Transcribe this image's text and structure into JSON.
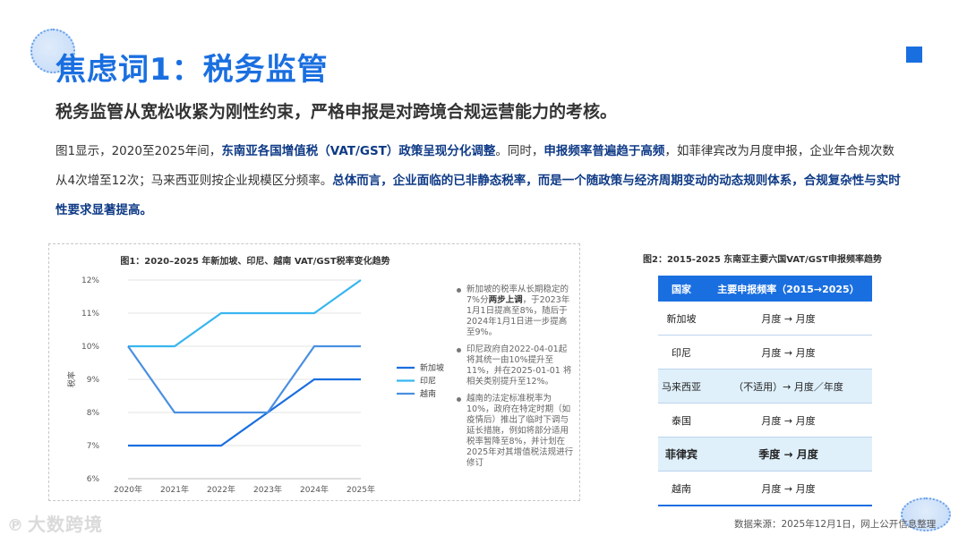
{
  "header": {
    "title": "焦虑词1：税务监管",
    "subtitle": "税务监管从宽松收紧为刚性约束，严格申报是对跨境合规运营能力的考核。"
  },
  "body": {
    "p1": "图1显示，2020至2025年间，",
    "p1_hl": "东南亚各国增值税（VAT/GST）政策呈现分化调整",
    "p2": "。同时，",
    "p2_hl": "申报频率普遍趋于高频",
    "p3": "，如菲律宾改为月度申报，企业年合规次数从4次增至12次；马来西亚则按企业规模区分频率。",
    "p3_hl": "总体而言，企业面临的已非静态税率，而是一个随政策与经济周期变动的动态规则体系，合规复杂性与实时性要求显著提高。"
  },
  "chart_title": "图1：2020–2025 年新加坡、印尼、越南 VAT/GST税率变化趋势",
  "chart_data": {
    "type": "line",
    "categories": [
      "2020年",
      "2021年",
      "2022年",
      "2023年",
      "2024年",
      "2025年"
    ],
    "ylabel": "税率",
    "ylim": [
      6,
      12
    ],
    "yticks": [
      "6%",
      "7%",
      "8%",
      "9%",
      "10%",
      "11%",
      "12%"
    ],
    "grid": true,
    "legend_position": "right",
    "series": [
      {
        "name": "新加坡",
        "values": [
          7,
          7,
          7,
          8,
          9,
          9
        ],
        "color": "#1a6fe0"
      },
      {
        "name": "印尼",
        "values": [
          10,
          10,
          11,
          11,
          11,
          12
        ],
        "color": "#38b6f0"
      },
      {
        "name": "越南",
        "values": [
          10,
          8,
          8,
          8,
          10,
          10
        ],
        "color": "#4a90e2"
      }
    ]
  },
  "notes": [
    {
      "a": "新加坡的税率从长期稳定的7%分",
      "b": "两步上调",
      "c": "，于2023年1月1日提高至8%，随后于2024年1月1日进一步提高至9%。"
    },
    {
      "a": "印尼政府自2022-04-01起将其统一由10%提升至11%，并在2025-01-01 将相关类别提升至12%。",
      "b": "",
      "c": ""
    },
    {
      "a": "越南的法定标准税率为10%，政府在特定时期（如疫情后）推出了临时下调与延长措施，例如将部分适用税率暂降至8%，并计划在2025年对其增值税法规进行修订",
      "b": "",
      "c": ""
    }
  ],
  "table": {
    "title": "图2：2015-2025 东南亚主要六国VAT/GST申报频率趋势",
    "headers": [
      "国家",
      "主要申报频率（2015→2025）"
    ],
    "rows": [
      {
        "country": "新加坡",
        "freq": "月度 → 月度"
      },
      {
        "country": "印尼",
        "freq": "月度 → 月度"
      },
      {
        "country": "马来西亚",
        "freq": "（不适用）→ 月度／年度"
      },
      {
        "country": "泰国",
        "freq": "月度 → 月度"
      },
      {
        "country": "菲律宾",
        "freq": "季度 → 月度"
      },
      {
        "country": "越南",
        "freq": "月度 → 月度"
      }
    ]
  },
  "source": "数据来源：2025年12月1日，网上公开信息整理",
  "logo": "大数跨境"
}
